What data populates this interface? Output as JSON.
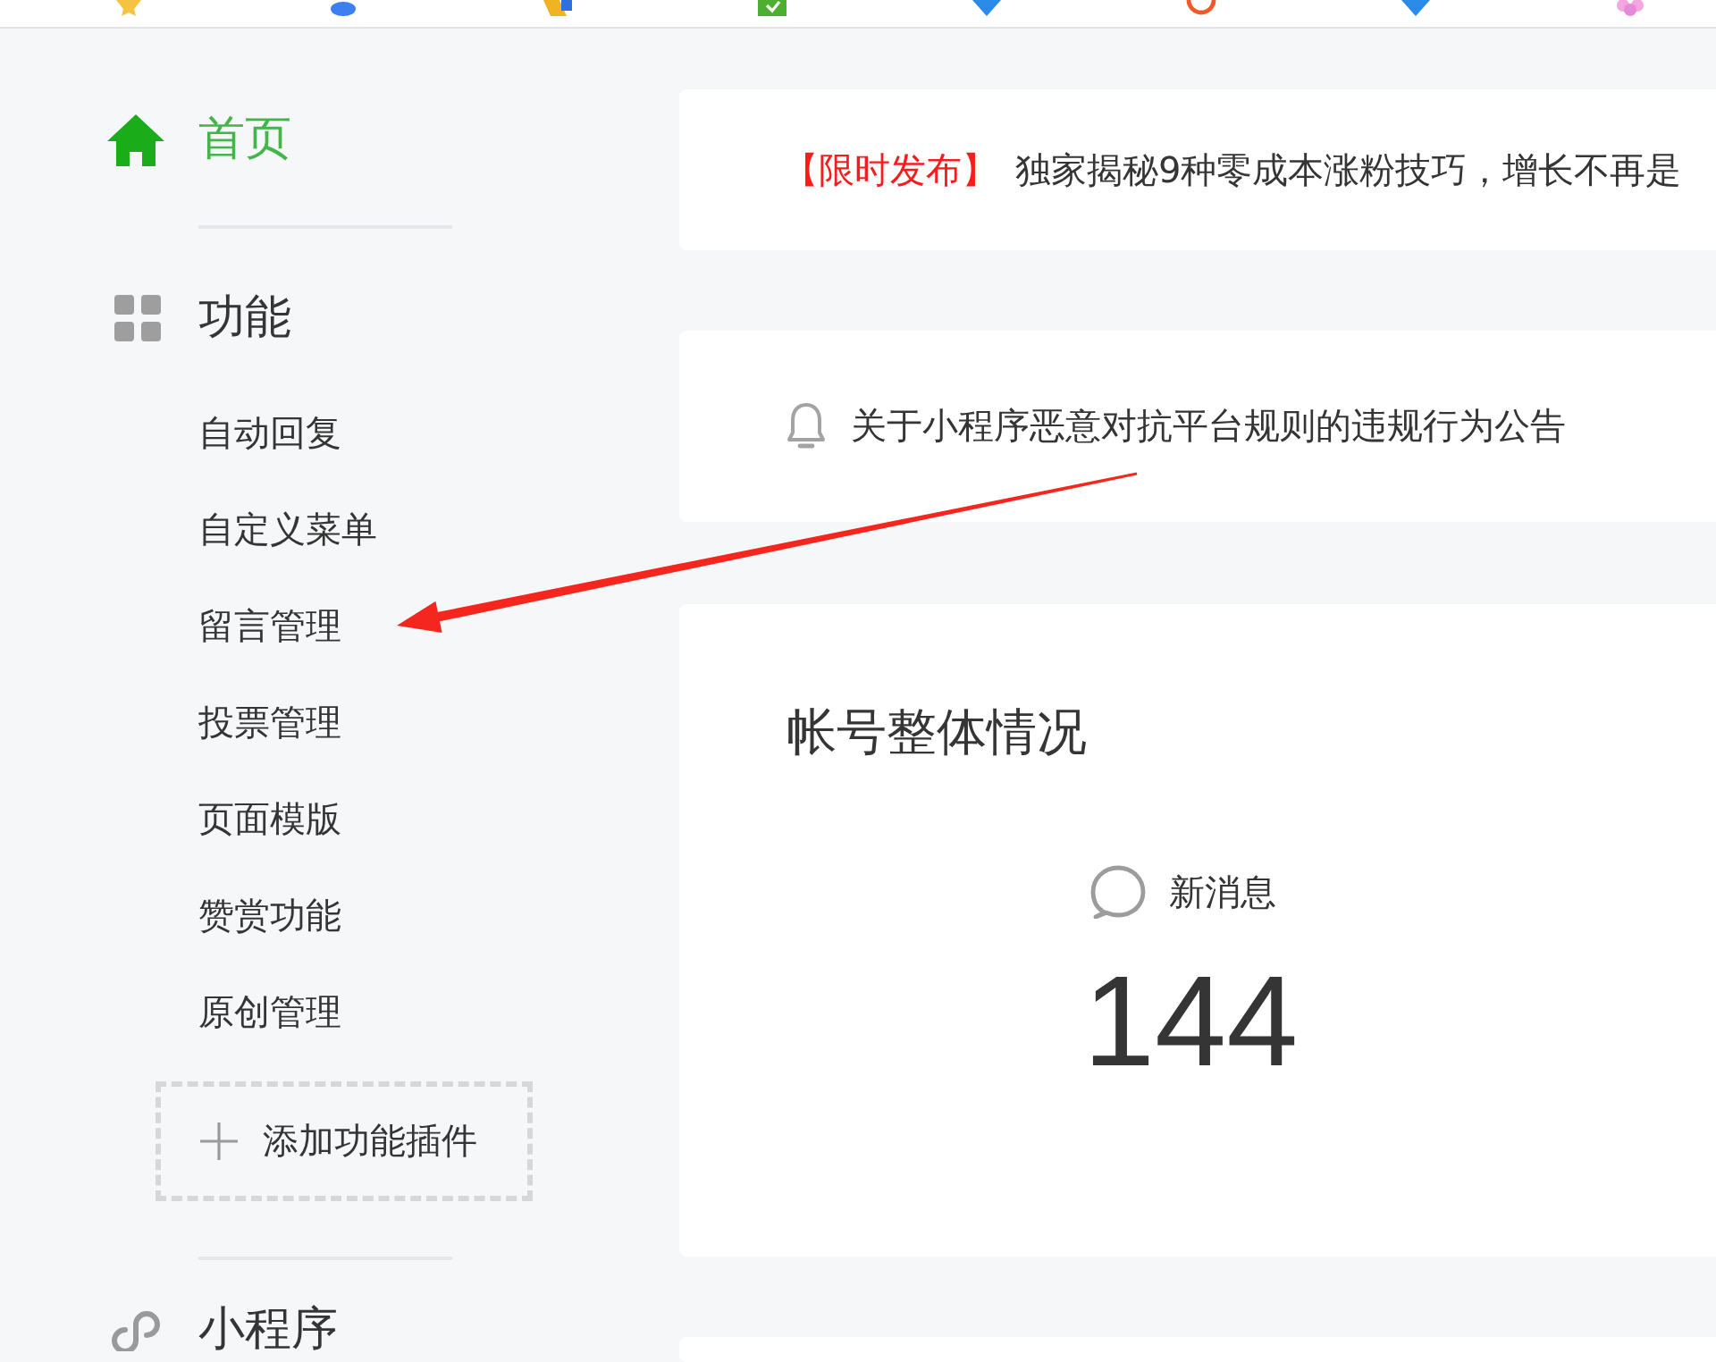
{
  "sidebar": {
    "home": {
      "label": "首页",
      "selected": true
    },
    "features": {
      "title": "功能",
      "items": [
        {
          "label": "自动回复",
          "selected": false
        },
        {
          "label": "自定义菜单",
          "selected": false
        },
        {
          "label": "留言管理",
          "selected": false
        },
        {
          "label": "投票管理",
          "selected": false
        },
        {
          "label": "页面模版",
          "selected": false
        },
        {
          "label": "赞赏功能",
          "selected": false
        },
        {
          "label": "原创管理",
          "selected": false
        }
      ],
      "add_button": "添加功能插件"
    },
    "mini_program": {
      "title": "小程序"
    }
  },
  "banner": {
    "tag": "【限时发布】",
    "headline": "独家揭秘9种零成本涨粉技巧，增长不再是"
  },
  "notice": {
    "text": "关于小程序恶意对抗平台规则的违规行为公告"
  },
  "overview": {
    "title": "帐号整体情况",
    "stats": [
      {
        "label": "新消息",
        "value": "144"
      }
    ]
  }
}
